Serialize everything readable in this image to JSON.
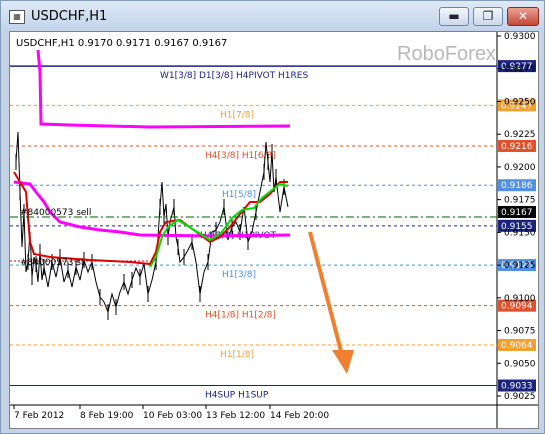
{
  "window": {
    "title": "USDCHF,H1",
    "buttons": {
      "minimize": "▬",
      "restore": "❐",
      "close": "✕"
    }
  },
  "chart": {
    "symbol_info": "USDCHF,H1  0.9170 0.9171 0.9167 0.9167",
    "watermark": "RoboForex",
    "y_ticks": [
      "0.9300",
      "0.9275",
      "0.9250",
      "0.9225",
      "0.9200",
      "0.9175",
      "0.9150",
      "0.9125",
      "0.9100",
      "0.9075",
      "0.9050",
      "0.9025"
    ],
    "x_ticks": [
      "7 Feb 2012",
      "8 Feb 19:00",
      "10 Feb 03:00",
      "13 Feb 12:00",
      "14 Feb 20:00"
    ],
    "levels": [
      {
        "label": "W1[3/8] D1[3/8] H4PIVOT H1RES",
        "price": "0.9277",
        "color": "#1a237e"
      },
      {
        "label": "H1[7/8]",
        "price": "0.9247",
        "color": "#f0a030"
      },
      {
        "label": "H4[3/8] H1[6/8]",
        "price": "0.9216",
        "color": "#e0502a"
      },
      {
        "label": "H1[5/8]",
        "price": "0.9186",
        "color": "#5090e0"
      },
      {
        "label": "H4[2/8] H1PIVOT",
        "price": "0.9155",
        "color": "#1a237e"
      },
      {
        "label": "H1[3/8]",
        "price": "0.9125",
        "color": "#5090e0"
      },
      {
        "label": "H4[1/8] H1[2/8]",
        "price": "0.9094",
        "color": "#e0502a"
      },
      {
        "label": "H1[1/8]",
        "price": "0.9064",
        "color": "#f0a030"
      },
      {
        "label": "H4SUP H1SUP",
        "price": "0.9033",
        "color": "#1a237e"
      }
    ],
    "current_price": "0.9167",
    "order_labels": [
      "#84000573 sell",
      "#84000573 sl"
    ],
    "colors": {
      "price": "#000000",
      "magenta": "#ff00ff",
      "red": "#e00000",
      "green": "#00dd00",
      "arrow": "#f08030"
    }
  }
}
